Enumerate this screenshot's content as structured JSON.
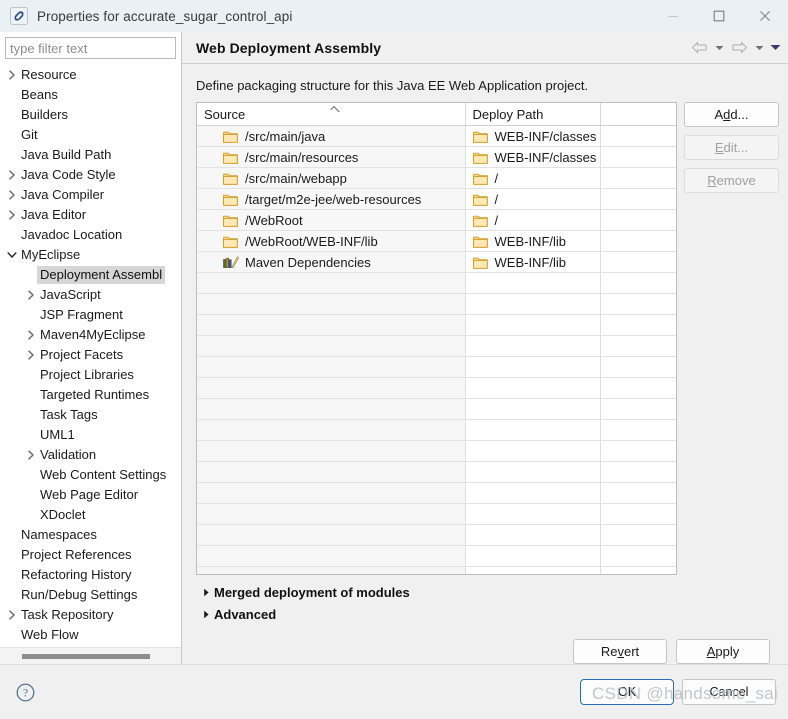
{
  "window": {
    "title": "Properties for accurate_sugar_control_api",
    "icon": "eclipse-properties-icon",
    "controls": {
      "minimize": "minimize-icon",
      "maximize": "maximize-icon",
      "close": "close-icon"
    }
  },
  "sidebar": {
    "filter": {
      "value": "",
      "placeholder": "type filter text"
    },
    "items": [
      {
        "label": "Resource",
        "indent": 0,
        "arrow": "collapsed",
        "selected": false
      },
      {
        "label": "Beans",
        "indent": 0,
        "arrow": "none",
        "selected": false
      },
      {
        "label": "Builders",
        "indent": 0,
        "arrow": "none",
        "selected": false
      },
      {
        "label": "Git",
        "indent": 0,
        "arrow": "none",
        "selected": false
      },
      {
        "label": "Java Build Path",
        "indent": 0,
        "arrow": "none",
        "selected": false
      },
      {
        "label": "Java Code Style",
        "indent": 0,
        "arrow": "collapsed",
        "selected": false
      },
      {
        "label": "Java Compiler",
        "indent": 0,
        "arrow": "collapsed",
        "selected": false
      },
      {
        "label": "Java Editor",
        "indent": 0,
        "arrow": "collapsed",
        "selected": false
      },
      {
        "label": "Javadoc Location",
        "indent": 0,
        "arrow": "none",
        "selected": false
      },
      {
        "label": "MyEclipse",
        "indent": 0,
        "arrow": "expanded",
        "selected": false
      },
      {
        "label": "Deployment Assembl",
        "indent": 1,
        "arrow": "none",
        "selected": true
      },
      {
        "label": "JavaScript",
        "indent": 1,
        "arrow": "collapsed",
        "selected": false
      },
      {
        "label": "JSP Fragment",
        "indent": 1,
        "arrow": "none",
        "selected": false
      },
      {
        "label": "Maven4MyEclipse",
        "indent": 1,
        "arrow": "collapsed",
        "selected": false
      },
      {
        "label": "Project Facets",
        "indent": 1,
        "arrow": "collapsed",
        "selected": false
      },
      {
        "label": "Project Libraries",
        "indent": 1,
        "arrow": "none",
        "selected": false
      },
      {
        "label": "Targeted Runtimes",
        "indent": 1,
        "arrow": "none",
        "selected": false
      },
      {
        "label": "Task Tags",
        "indent": 1,
        "arrow": "none",
        "selected": false
      },
      {
        "label": "UML1",
        "indent": 1,
        "arrow": "none",
        "selected": false
      },
      {
        "label": "Validation",
        "indent": 1,
        "arrow": "collapsed",
        "selected": false
      },
      {
        "label": "Web Content Settings",
        "indent": 1,
        "arrow": "none",
        "selected": false
      },
      {
        "label": "Web Page Editor",
        "indent": 1,
        "arrow": "none",
        "selected": false
      },
      {
        "label": "XDoclet",
        "indent": 1,
        "arrow": "none",
        "selected": false
      },
      {
        "label": "Namespaces",
        "indent": 0,
        "arrow": "none",
        "selected": false
      },
      {
        "label": "Project References",
        "indent": 0,
        "arrow": "none",
        "selected": false
      },
      {
        "label": "Refactoring History",
        "indent": 0,
        "arrow": "none",
        "selected": false
      },
      {
        "label": "Run/Debug Settings",
        "indent": 0,
        "arrow": "none",
        "selected": false
      },
      {
        "label": "Task Repository",
        "indent": 0,
        "arrow": "collapsed",
        "selected": false
      },
      {
        "label": "Web Flow",
        "indent": 0,
        "arrow": "none",
        "selected": false
      }
    ]
  },
  "page": {
    "title": "Web Deployment Assembly",
    "description": "Define packaging structure for this Java EE Web Application project.",
    "nav": {
      "back": "back-arrow-icon",
      "back_menu": "chevron-down-icon",
      "forward": "forward-arrow-icon",
      "forward_menu": "chevron-down-icon",
      "page_menu": "chevron-down-icon"
    }
  },
  "table": {
    "columns": [
      {
        "label": "Source",
        "sorted": "asc"
      },
      {
        "label": "Deploy Path",
        "sorted": "none"
      },
      {
        "label": "",
        "sorted": "none"
      }
    ],
    "rows": [
      {
        "icon": "folder-icon",
        "source": "/src/main/java",
        "deploy_icon": "folder-icon",
        "deploy": "WEB-INF/classes"
      },
      {
        "icon": "folder-icon",
        "source": "/src/main/resources",
        "deploy_icon": "folder-icon",
        "deploy": "WEB-INF/classes"
      },
      {
        "icon": "folder-icon",
        "source": "/src/main/webapp",
        "deploy_icon": "folder-icon",
        "deploy": "/"
      },
      {
        "icon": "folder-icon",
        "source": "/target/m2e-jee/web-resources",
        "deploy_icon": "folder-icon",
        "deploy": "/"
      },
      {
        "icon": "folder-icon",
        "source": "/WebRoot",
        "deploy_icon": "folder-icon",
        "deploy": "/"
      },
      {
        "icon": "folder-icon",
        "source": "/WebRoot/WEB-INF/lib",
        "deploy_icon": "folder-icon",
        "deploy": "WEB-INF/lib"
      },
      {
        "icon": "books-icon",
        "source": "Maven Dependencies",
        "deploy_icon": "folder-icon",
        "deploy": "WEB-INF/lib"
      }
    ],
    "empty_row_count": 16
  },
  "side_buttons": [
    {
      "label": "Add...",
      "mnemonic": "d",
      "enabled": true
    },
    {
      "label": "Edit...",
      "mnemonic": "E",
      "enabled": false
    },
    {
      "label": "Remove",
      "mnemonic": "R",
      "enabled": false
    }
  ],
  "expanders": [
    {
      "label": "Merged deployment of modules",
      "state": "collapsed"
    },
    {
      "label": "Advanced",
      "state": "collapsed"
    }
  ],
  "page_buttons": [
    {
      "label": "Revert",
      "mnemonic": "v"
    },
    {
      "label": "Apply",
      "mnemonic": "A"
    }
  ],
  "footer": {
    "help_icon": "help-question-icon",
    "buttons": [
      {
        "label": "OK",
        "focused": true
      },
      {
        "label": "Cancel",
        "focused": false
      }
    ]
  },
  "watermark": "CSDN @handsome_sai",
  "colors": {
    "titlebar": "#eaf1f5",
    "dialog_bg": "#f0f0f0",
    "panel_bg": "#ffffff",
    "selection": "#d6d6d6",
    "focus_border": "#2b6cb8",
    "folder": "#e8b33f"
  }
}
